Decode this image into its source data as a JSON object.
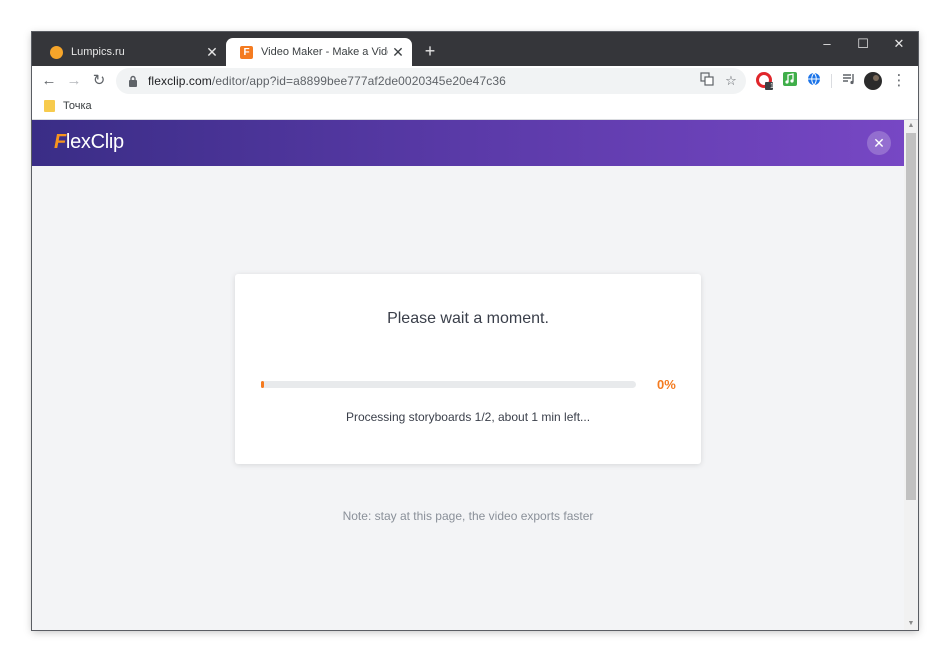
{
  "tabs": [
    {
      "title": "Lumpics.ru",
      "active": false,
      "favicon": "lumpics-favicon"
    },
    {
      "title": "Video Maker - Make a Video for",
      "active": true,
      "favicon": "flexclip-favicon"
    }
  ],
  "newtab_label": "+",
  "window_controls": {
    "minimize": "–",
    "maximize": "☐",
    "close": "✕"
  },
  "toolbar": {
    "back": "←",
    "forward": "→",
    "reload": "↻",
    "url_host": "flexclip.com",
    "url_path": "/editor/app?id=a8899bee777af2de0020345e20e47c36",
    "menu": "⋮",
    "extension_badge": "1"
  },
  "bookmarks": [
    {
      "label": "Точка"
    }
  ],
  "app": {
    "logo_f": "F",
    "logo_rest": "lexClip",
    "close_label": "✕",
    "brand_color": "#f47b20",
    "header_gradient": [
      "#3a2d86",
      "#7747c4"
    ]
  },
  "export": {
    "title": "Please wait a moment.",
    "progress": 0,
    "percent_label": "0%",
    "status": "Processing storyboards 1/2, about 1 min left...",
    "note": "Note: stay at this page, the video exports faster"
  }
}
